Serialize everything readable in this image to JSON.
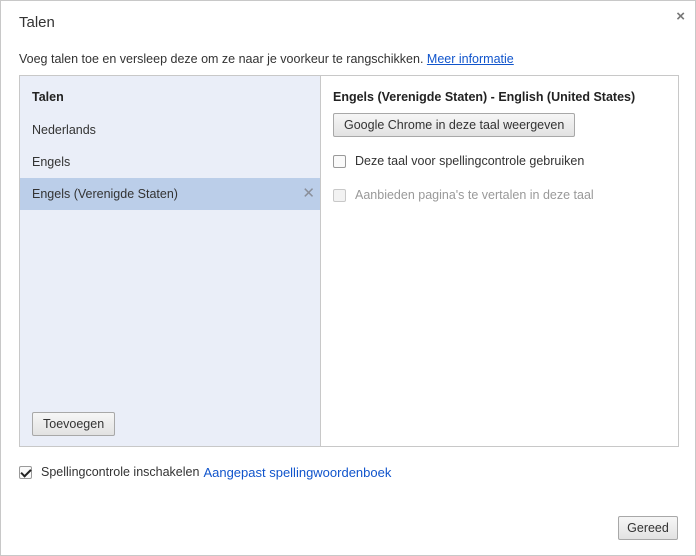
{
  "dialog": {
    "title": "Talen",
    "close_glyph": "×",
    "intro_text": "Voeg talen toe en versleep deze om ze naar je voorkeur te rangschikken.",
    "intro_link": "Meer informatie"
  },
  "language_list": {
    "header": "Talen",
    "items": [
      {
        "label": "Nederlands",
        "selected": false
      },
      {
        "label": "Engels",
        "selected": false
      },
      {
        "label": "Engels (Verenigde Staten)",
        "selected": true
      }
    ],
    "remove_glyph": "✕",
    "add_button": "Toevoegen"
  },
  "detail": {
    "title": "Engels (Verenigde Staten) - English (United States)",
    "display_button": "Google Chrome in deze taal weergeven",
    "spellcheck_label": "Deze taal voor spellingcontrole gebruiken",
    "spellcheck_checked": false,
    "translate_label": "Aanbieden pagina's te vertalen in deze taal",
    "translate_disabled": true
  },
  "footer": {
    "spellcheck_enable_label": "Spellingcontrole inschakelen",
    "spellcheck_enable_checked": true,
    "custom_dictionary_link": "Aangepast spellingwoordenboek",
    "done_button": "Gereed"
  },
  "colors": {
    "link": "#1155cc",
    "list_background": "#eaeef8",
    "selected_row": "#bbcee9",
    "border": "#c8c8c8"
  }
}
